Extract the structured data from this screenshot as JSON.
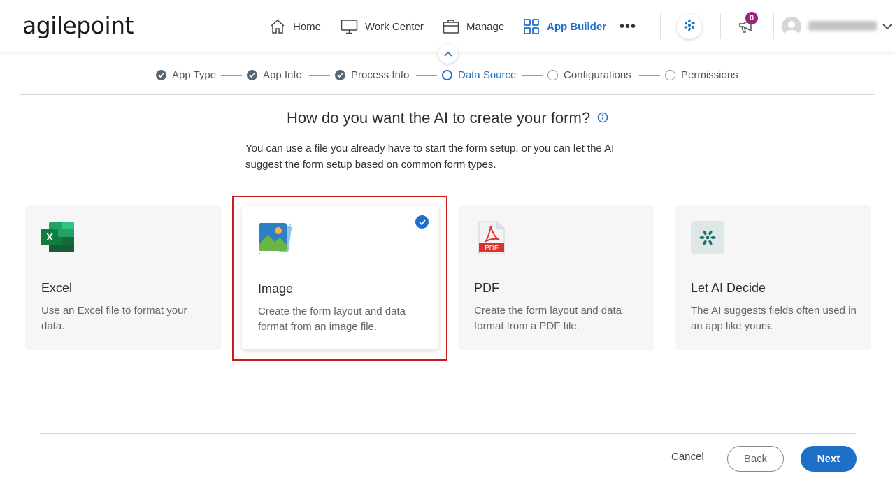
{
  "brand": {
    "logo_text": "agilepoint"
  },
  "nav": {
    "items": [
      {
        "label": "Home",
        "icon": "home-icon"
      },
      {
        "label": "Work Center",
        "icon": "monitor-icon"
      },
      {
        "label": "Manage",
        "icon": "briefcase-icon"
      },
      {
        "label": "App Builder",
        "icon": "grid-icon",
        "active": true
      }
    ],
    "more_label": "•••",
    "notifications_count": "0",
    "accent_color": "#1e6fc8",
    "badge_color": "#a0207e"
  },
  "stepper": {
    "steps": [
      {
        "label": "App Type",
        "state": "done"
      },
      {
        "label": "App Info",
        "state": "done"
      },
      {
        "label": "Process Info",
        "state": "done"
      },
      {
        "label": "Data Source",
        "state": "current"
      },
      {
        "label": "Configurations",
        "state": "todo"
      },
      {
        "label": "Permissions",
        "state": "todo"
      }
    ]
  },
  "main": {
    "heading": "How do you want the AI to create your form?",
    "subtext": "You can use a file you already have to start the form setup, or you can let the AI suggest the form setup based on common form types.",
    "cards": [
      {
        "title": "Excel",
        "description": "Use an Excel file to format your data.",
        "icon": "excel-icon",
        "selected": false
      },
      {
        "title": "Image",
        "description": "Create the form layout and data format from an image file.",
        "icon": "image-icon",
        "selected": true
      },
      {
        "title": "PDF",
        "description": "Create the form layout and data format from a PDF file.",
        "icon": "pdf-icon",
        "selected": false
      },
      {
        "title": "Let AI Decide",
        "description": "The AI suggests fields often used in an app like yours.",
        "icon": "ai-icon",
        "selected": false
      }
    ],
    "pdf_icon_label": "PDF",
    "excel_icon_letter": "X"
  },
  "footer": {
    "cancel_label": "Cancel",
    "back_label": "Back",
    "next_label": "Next"
  }
}
